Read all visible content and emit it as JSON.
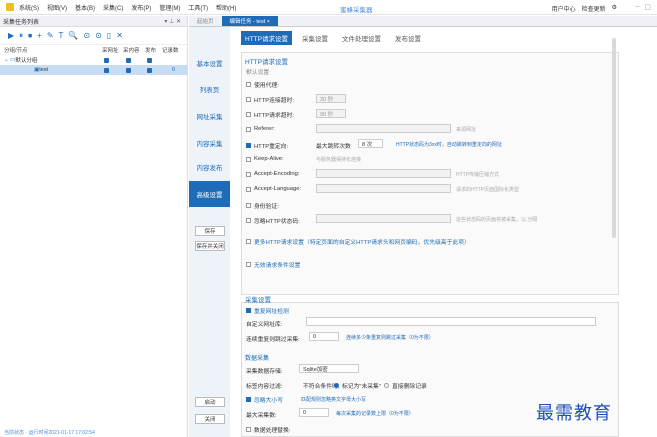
{
  "menubar": {
    "menus": [
      "系统(S)",
      "视图(V)",
      "基本(B)",
      "采集(C)",
      "发布(P)",
      "管理(M)",
      "工具(T)",
      "帮助(H)"
    ],
    "app_title": "蜜蜂采集器",
    "user_center": "用户中心",
    "check_update": "检查更新"
  },
  "left_panel": {
    "title": "采集任务列表",
    "pin": "▾ ⊥ ✕",
    "toolbar": [
      "▶",
      "⏸",
      "⏹",
      "+",
      "✎",
      "T",
      "🔍",
      "⊙",
      "⊙",
      "▯",
      "✕"
    ],
    "columns": {
      "name": "分组/节点",
      "c1": "采网址",
      "c2": "采内容",
      "c3": "发布",
      "c4": "记录数"
    },
    "group": "默认分组",
    "task": "test",
    "task_count": "0",
    "status": "当前状态 · 运行时间2021-01-17 17:02:54"
  },
  "tabs": {
    "start": "起始页",
    "active": "编辑任务 - test ×"
  },
  "sidenav": {
    "items": [
      "基本设置",
      "列表页",
      "网址采集",
      "内容采集",
      "内容发布",
      "高级设置"
    ],
    "save": "保存",
    "save_close": "保存并关闭",
    "start": "启动",
    "close": "关闭"
  },
  "subtabs": [
    "HTTP请求设置",
    "采集设置",
    "文件处理设置",
    "发布设置"
  ],
  "http": {
    "title": "HTTP请求设置",
    "subtitle": "默认设置:",
    "proxy": "使用代理:",
    "connect_timeout": "HTTP连接超时:",
    "connect_value": "30 秒",
    "request_timeout": "HTTP请求超时:",
    "request_value": "90 秒",
    "referer": "Referer:",
    "referer_hint": "来源网址",
    "redirect": "HTTP重定向:",
    "max_jumps": "最大跳转次数",
    "jumps_value": "8 次",
    "redirect_hint": "HTTP状态码为3xx时，自动跳转到重定向的网址",
    "keepalive": "Keep-Alive:",
    "keepalive_hint": "与服务器保持长连接",
    "accept_encoding": "Accept-Encoding:",
    "encoding_hint": "HTTP传输压缩方式",
    "accept_language": "Accept-Language:",
    "language_hint": "请求的HTTP页面国际化类型",
    "auth": "身份验证:",
    "ignore_status": "忽略HTTP状态码:",
    "ignore_hint": "这些状态码的页面将被采集，以,分隔",
    "more_settings": "更多HTTP请求设置（特定页面的自定义HTTP请求头和网页编码，优先级高于此项）",
    "no_condition": "无效请求条件设置"
  },
  "collect": {
    "title": "采集设置",
    "dedup": "重复网址检测",
    "dedup_lib": "自定义网址库:",
    "dup_skip": "连续重复则跳过采集:",
    "dup_value": "0",
    "dup_hint": "连续多少条重复则跳过采集（0为不限）",
    "data_title": "数据采集",
    "storage": "采集数据存储:",
    "storage_value": "Sqlite加密",
    "title_filter": "标签内容过滤:",
    "no_match": "不符合条件时,",
    "mark_uncollected": "标记为\"未采集\"",
    "delete_record": "直接删除记录",
    "ignore_case": "忽略大小写",
    "ignore_case_hint": "匹配规则忽略英文字母大小写",
    "max_count": "最大采集数:",
    "max_value": "0",
    "max_hint": "每次采集的记录数上限（0为不限）",
    "data_process": "数据处理替换:"
  },
  "watermark": "最需教育",
  "colors": {
    "accent": "#1e6bb8",
    "nav_bg": "#eef3f9"
  }
}
